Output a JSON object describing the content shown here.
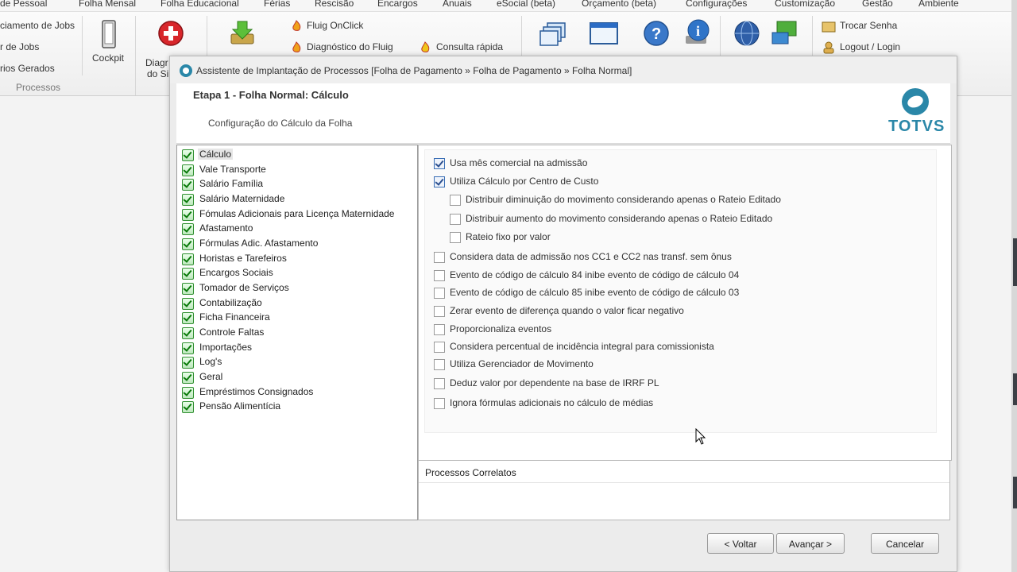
{
  "menubar": {
    "items": [
      "de Pessoal",
      "Folha Mensal",
      "Folha Educacional",
      "Férias",
      "Rescisão",
      "Encargos",
      "Anuais",
      "eSocial (beta)",
      "Orçamento (beta)",
      "Configurações",
      "Customização",
      "Gestão",
      "Ambiente"
    ]
  },
  "ribbon": {
    "left_items": [
      "ciamento de Jobs",
      "r de Jobs",
      "rios Gerados"
    ],
    "cockpit_label": "Cockpit",
    "diag_label_1": "Diagr",
    "diag_label_2": "do Si",
    "group_label": "Processos",
    "links": {
      "fluig_onclick": "Fluig OnClick",
      "diagnostico_fluig": "Diagnóstico do Fluig",
      "consulta_rapida": "Consulta rápida",
      "trocar_senha": "Trocar Senha",
      "logout_login": "Logout / Login"
    }
  },
  "dialog": {
    "title": "Assistente de Implantação de Processos [Folha de Pagamento » Folha de Pagamento » Folha Normal]",
    "step_title": "Etapa 1 - Folha Normal: Cálculo",
    "step_subtitle": "Configuração do Cálculo da Folha",
    "brand": "TOTVS",
    "nav_items": [
      {
        "label": "Cálculo",
        "selected": true
      },
      {
        "label": "Vale Transporte"
      },
      {
        "label": "Salário Família"
      },
      {
        "label": "Salário Maternidade"
      },
      {
        "label": "Fómulas Adicionais para Licença Maternidade"
      },
      {
        "label": "Afastamento"
      },
      {
        "label": "Fórmulas Adic. Afastamento"
      },
      {
        "label": "Horistas e Tarefeiros"
      },
      {
        "label": "Encargos Sociais"
      },
      {
        "label": "Tomador de Serviços"
      },
      {
        "label": "Contabilização"
      },
      {
        "label": "Ficha Financeira"
      },
      {
        "label": "Controle Faltas"
      },
      {
        "label": "Importações"
      },
      {
        "label": "Log's"
      },
      {
        "label": "Geral"
      },
      {
        "label": "Empréstimos Consignados"
      },
      {
        "label": "Pensão Alimentícia"
      }
    ],
    "options": [
      {
        "label": "Usa mês comercial na admissão",
        "checked": true,
        "level": 0
      },
      {
        "label": "Utiliza Cálculo por Centro de Custo",
        "checked": true,
        "level": 0
      },
      {
        "label": "Distribuir diminuição do movimento considerando apenas o Rateio Editado",
        "checked": false,
        "level": 1
      },
      {
        "label": "Distribuir aumento do movimento considerando apenas o Rateio Editado",
        "checked": false,
        "level": 1
      },
      {
        "label": "Rateio fixo por valor",
        "checked": false,
        "level": 1
      },
      {
        "label": "Considera data de admissão nos CC1 e CC2 nas transf. sem ônus",
        "checked": false,
        "level": 0
      },
      {
        "label": "Evento de código de cálculo 84 inibe evento de código de cálculo 04",
        "checked": false,
        "level": 0
      },
      {
        "label": "Evento de código de cálculo 85 inibe evento de código de cálculo 03",
        "checked": false,
        "level": 0
      },
      {
        "label": "Zerar evento de diferença quando o valor ficar negativo",
        "checked": false,
        "level": 0
      },
      {
        "label": "Proporcionaliza eventos",
        "checked": false,
        "level": 0
      },
      {
        "label": "Considera percentual de incidência integral para comissionista",
        "checked": false,
        "level": 0
      },
      {
        "label": "Utiliza Gerenciador de Movimento",
        "checked": false,
        "level": 0
      },
      {
        "label": "Deduz valor por dependente na base de IRRF PL",
        "checked": false,
        "level": 0
      },
      {
        "label": "Ignora fórmulas adicionais no cálculo de médias",
        "checked": false,
        "level": 0
      }
    ],
    "correlatos_title": "Processos Correlatos",
    "buttons": {
      "voltar": "< Voltar",
      "avancar": "Avançar >",
      "cancelar": "Cancelar"
    }
  },
  "colors": {
    "brand": "#2a87a8",
    "check_green": "#0a7a0a"
  }
}
